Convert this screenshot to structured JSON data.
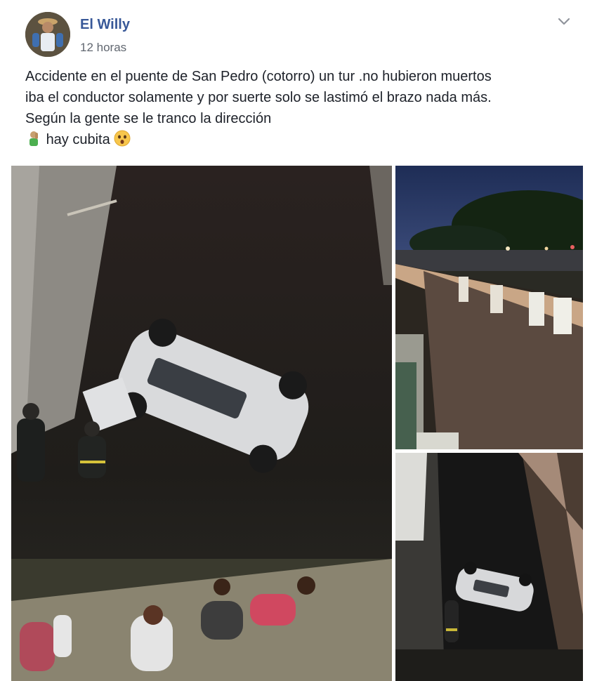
{
  "post": {
    "author": "El Willy",
    "timestamp": "12 horas",
    "text_lines": [
      "Accidente en el puente de San Pedro (cotorro) un tur .no hubieron muertos",
      "iba el conductor solamente y por suerte solo se lastimó el brazo nada más.",
      "Según la gente se le tranco la dirección"
    ],
    "last_line_text": "hay cubita",
    "icons": {
      "menu": "chevron-down-icon",
      "emoji_1": "person-facepalming-emoji",
      "emoji_2": "astonished-face-emoji"
    }
  },
  "photos": [
    {
      "scene": "overturned white car in ravine below bridge at night"
    },
    {
      "scene": "bridge railing at dusk with trees"
    },
    {
      "scene": "view down from bridge to overturned car"
    }
  ],
  "colors": {
    "author_link": "#385898",
    "secondary_text": "#616770",
    "body_text": "#1d2129",
    "chevron": "#90949c"
  }
}
